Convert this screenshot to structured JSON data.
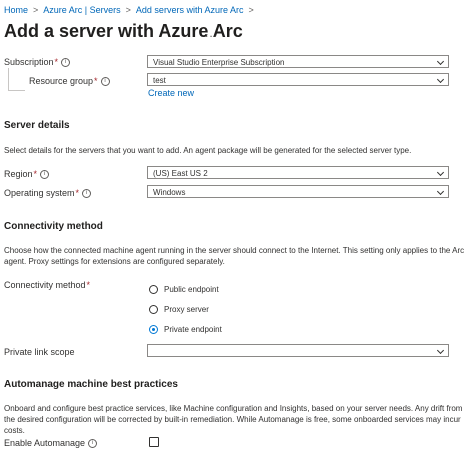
{
  "breadcrumb": [
    {
      "label": "Home"
    },
    {
      "label": "Azure Arc | Servers"
    },
    {
      "label": "Add servers with Azure Arc"
    }
  ],
  "page_title": "Add a server with Azure Arc",
  "more_label": "...",
  "project": {
    "subscription_label": "Subscription",
    "subscription_value": "Visual Studio Enterprise Subscription",
    "resource_group_label": "Resource group",
    "resource_group_value": "test",
    "create_new": "Create new"
  },
  "server_details": {
    "title": "Server details",
    "description": "Select details for the servers that you want to add. An agent package will be generated for the selected server type.",
    "region_label": "Region",
    "region_value": "(US) East US 2",
    "os_label": "Operating system",
    "os_value": "Windows"
  },
  "connectivity": {
    "title": "Connectivity method",
    "description": "Choose how the connected machine agent running in the server should connect to the Internet. This setting only applies to the Arc agent. Proxy settings for extensions are configured separately.",
    "method_label": "Connectivity method",
    "options": [
      {
        "label": "Public endpoint",
        "selected": false
      },
      {
        "label": "Proxy server",
        "selected": false
      },
      {
        "label": "Private endpoint",
        "selected": true
      }
    ],
    "private_link_label": "Private link scope",
    "private_link_value": ""
  },
  "automanage": {
    "title": "Automanage machine best practices",
    "description": "Onboard and configure best practice services, like Machine configuration and Insights, based on your server needs. Any drift from the desired configuration will be corrected by built-in remediation. While Automanage is free, some onboarded services may incur costs.",
    "enable_label": "Enable Automanage",
    "enabled": false
  },
  "symbols": {
    "required": "*",
    "info": "i",
    "separator": ">"
  },
  "colors": {
    "link": "#0067b8",
    "accent": "#0078d4",
    "required": "#a4262c",
    "border": "#8a8886"
  }
}
